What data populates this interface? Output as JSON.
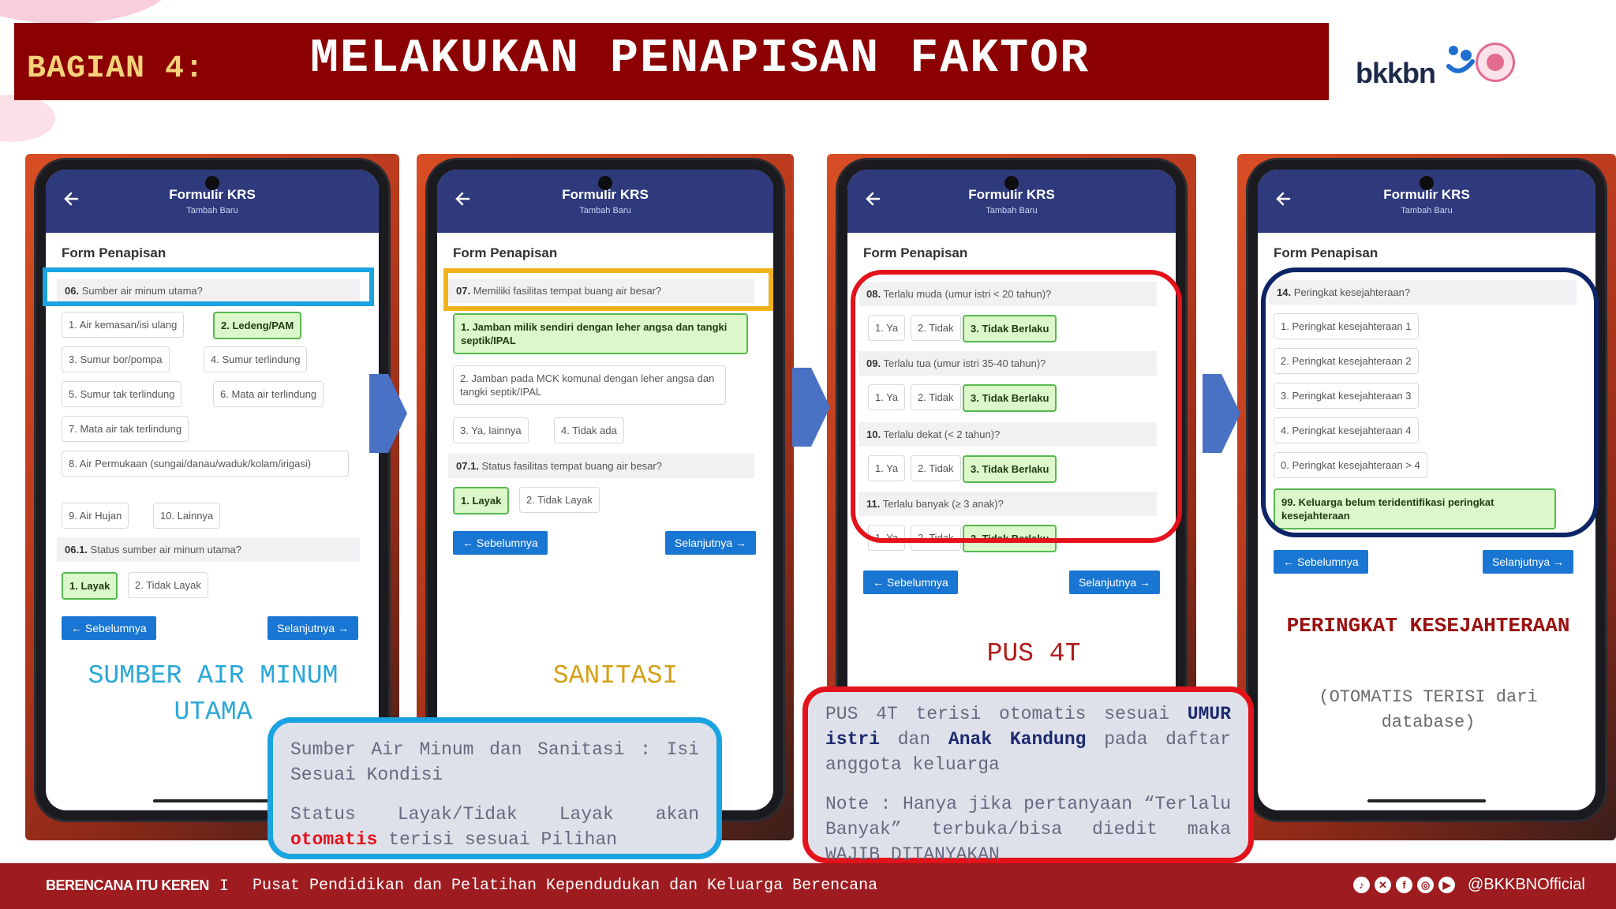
{
  "header": {
    "label": "BAGIAN 4:",
    "title": "MELAKUKAN PENAPISAN FAKTOR",
    "logo": "bkkbn"
  },
  "phones": [
    {
      "appbar_title": "Formulir KRS",
      "appbar_sub": "Tambah Baru",
      "form_title": "Form Penapisan",
      "q1_num": "06.",
      "q1_text": "Sumber air minum utama?",
      "opts": [
        "1. Air kemasan/isi ulang",
        "2. Ledeng/PAM",
        "3. Sumur bor/pompa",
        "4. Sumur terlindung",
        "5. Sumur tak terlindung",
        "6. Mata air terlindung",
        "7. Mata air tak terlindung",
        "8. Air Permukaan (sungai/danau/waduk/kolam/irigasi)",
        "9. Air Hujan",
        "10. Lainnya"
      ],
      "q2_num": "06.1.",
      "q2_text": "Status sumber air minum utama?",
      "opts2": [
        "1. Layak",
        "2. Tidak Layak"
      ],
      "prev": "Sebelumnya",
      "next": "Selanjutnya",
      "caption": "SUMBER AIR MINUM UTAMA"
    },
    {
      "appbar_title": "Formulir KRS",
      "appbar_sub": "Tambah Baru",
      "form_title": "Form Penapisan",
      "q1_num": "07.",
      "q1_text": "Memiliki fasilitas tempat buang air besar?",
      "opts": [
        "1. Jamban milik sendiri dengan leher angsa dan tangki septik/IPAL",
        "2. Jamban pada MCK komunal dengan leher angsa dan tangki septik/IPAL",
        "3. Ya, lainnya",
        "4. Tidak ada"
      ],
      "q2_num": "07.1.",
      "q2_text": "Status fasilitas tempat buang air besar?",
      "opts2": [
        "1. Layak",
        "2. Tidak Layak"
      ],
      "prev": "Sebelumnya",
      "next": "Selanjutnya",
      "caption": "SANITASI"
    },
    {
      "appbar_title": "Formulir KRS",
      "appbar_sub": "Tambah Baru",
      "form_title": "Form Penapisan",
      "questions": [
        {
          "num": "08.",
          "text": "Terlalu muda (umur istri < 20 tahun)?"
        },
        {
          "num": "09.",
          "text": "Terlalu tua (umur istri 35-40 tahun)?"
        },
        {
          "num": "10.",
          "text": "Terlalu dekat (< 2 tahun)?"
        },
        {
          "num": "11.",
          "text": "Terlalu banyak (≥ 3 anak)?"
        }
      ],
      "opts": [
        "1. Ya",
        "2. Tidak",
        "3. Tidak Berlaku"
      ],
      "prev": "Sebelumnya",
      "next": "Selanjutnya",
      "caption": "PUS 4T"
    },
    {
      "appbar_title": "Formulir KRS",
      "appbar_sub": "Tambah Baru",
      "form_title": "Form Penapisan",
      "q1_num": "14.",
      "q1_text": "Peringkat kesejahteraan?",
      "opts": [
        "1. Peringkat kesejahteraan 1",
        "2. Peringkat kesejahteraan 2",
        "3. Peringkat kesejahteraan 3",
        "4. Peringkat kesejahteraan 4",
        "0. Peringkat kesejahteraan > 4",
        "99. Keluarga belum teridentifikasi peringkat kesejahteraan"
      ],
      "prev": "Sebelumnya",
      "next": "Selanjutnya",
      "caption": "PERINGKAT KESEJAHTERAAN",
      "caption_sub": "(OTOMATIS TERISI dari database)"
    }
  ],
  "callouts": {
    "blue": {
      "line1": "Sumber Air Minum dan Sanitasi : Isi Sesuai Kondisi",
      "line2_a": "Status Layak/Tidak Layak akan",
      "line2_b": "otomatis",
      "line2_c": "terisi sesuai Pilihan"
    },
    "red": {
      "p1_a": "PUS 4T terisi otomatis sesuai",
      "p1_b": "UMUR istri",
      "p1_c": "dan",
      "p1_d": "Anak Kandung",
      "p1_e": "pada daftar anggota keluarga",
      "p2": "Note : Hanya jika pertanyaan “Terlalu Banyak” terbuka/bisa diedit maka WAJIB DITANYAKAN"
    }
  },
  "footer": {
    "brand": "BERENCANA ITU KEREN",
    "sep": "I",
    "text": "Pusat Pendidikan dan Pelatihan Kependudukan dan Keluarga Berencana",
    "handle": "@BKKBNOfficial"
  },
  "colors": {
    "title_bg": "#8b0000",
    "title_label": "#f5d27a",
    "footer_bg": "#9e1b1f",
    "blue_box": "#1aa3e0",
    "gold_box": "#f2b21c",
    "red_box": "#e3121b",
    "navy_box": "#0d2466",
    "caption_blue": "#28a7d8",
    "caption_gold": "#d4a017",
    "caption_red": "#b11b1b",
    "selected_bg": "#dcf7c9",
    "selected_border": "#56b94e",
    "button_blue": "#1976d2",
    "appbar": "#2f3a7d",
    "arrow": "#4a72c4"
  }
}
